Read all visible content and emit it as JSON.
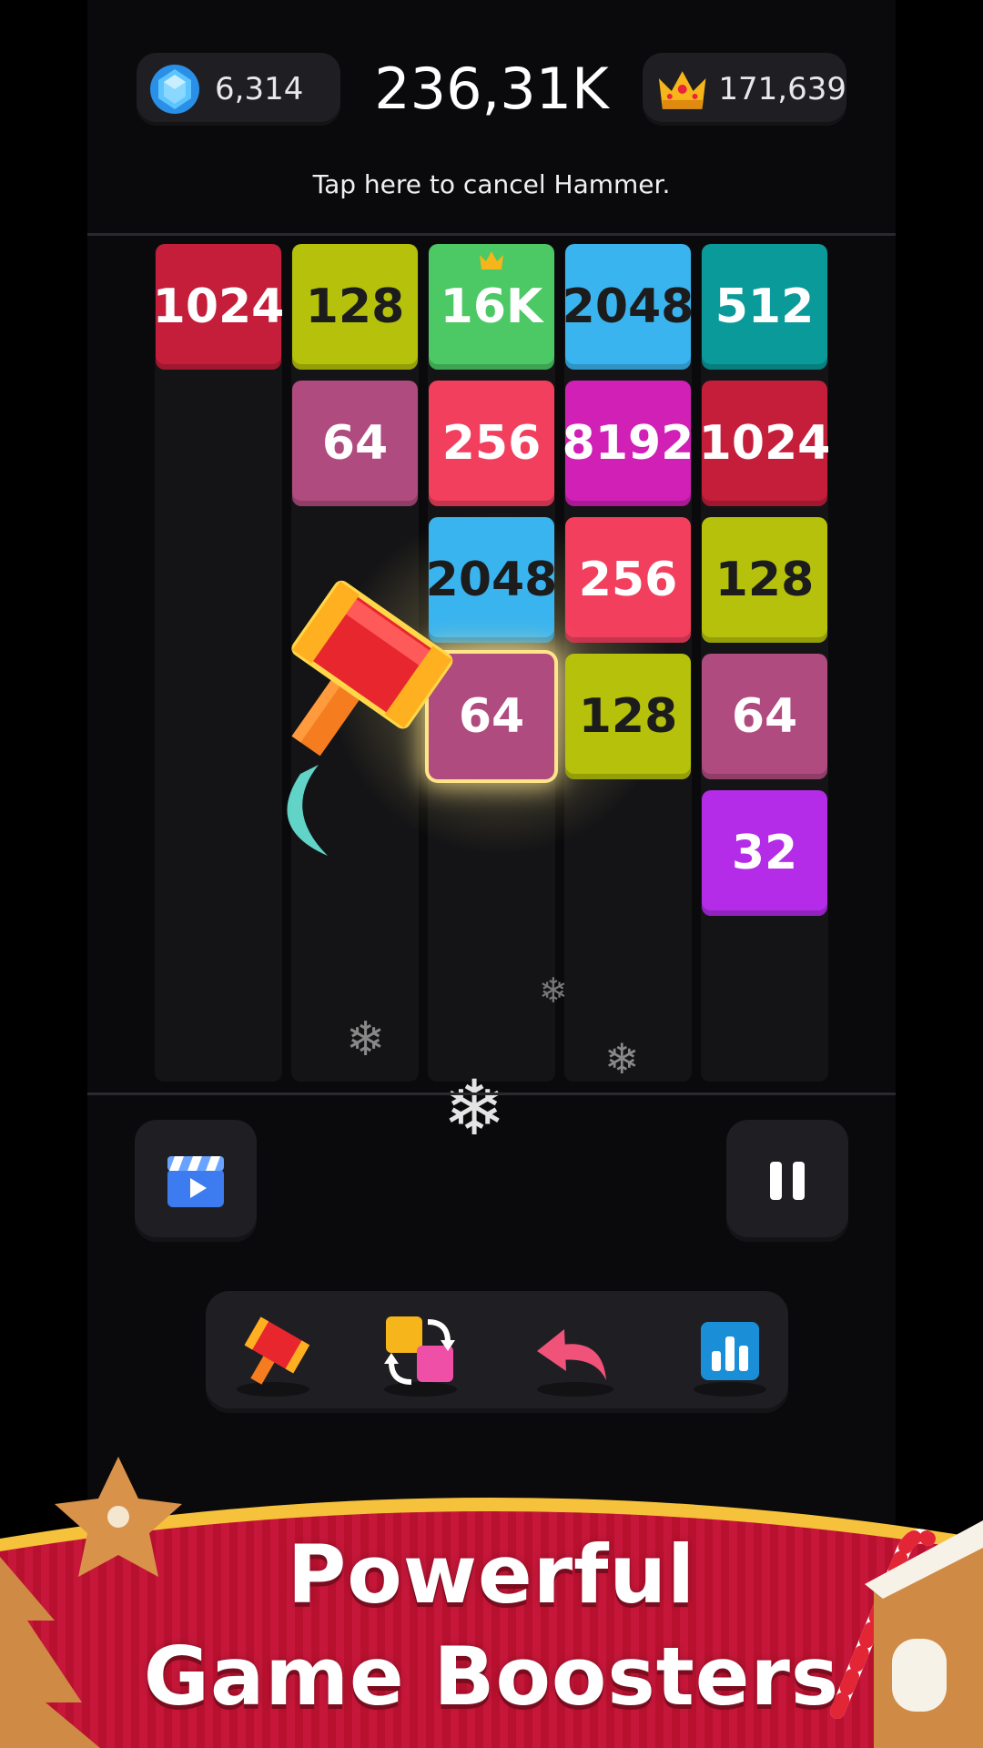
{
  "header": {
    "gems": "6,314",
    "score": "236,31K",
    "best": "171,639",
    "hint": "Tap here to cancel Hammer."
  },
  "board": {
    "tiles": [
      {
        "col": 0,
        "row": 0,
        "label": "1024",
        "color": "#c41e3a"
      },
      {
        "col": 1,
        "row": 0,
        "label": "128",
        "color": "#b5c10b"
      },
      {
        "col": 2,
        "row": 0,
        "label": "16K",
        "color": "#4cc864",
        "crown": true
      },
      {
        "col": 3,
        "row": 0,
        "label": "2048",
        "color": "#3ab4ef"
      },
      {
        "col": 4,
        "row": 0,
        "label": "512",
        "color": "#0a9a9a"
      },
      {
        "col": 1,
        "row": 1,
        "label": "64",
        "color": "#b04b7f"
      },
      {
        "col": 2,
        "row": 1,
        "label": "256",
        "color": "#f23f5e"
      },
      {
        "col": 3,
        "row": 1,
        "label": "8192",
        "color": "#d020b6"
      },
      {
        "col": 4,
        "row": 1,
        "label": "1024",
        "color": "#c41e3a"
      },
      {
        "col": 2,
        "row": 2,
        "label": "2048",
        "color": "#3ab4ef"
      },
      {
        "col": 3,
        "row": 2,
        "label": "256",
        "color": "#f23f5e"
      },
      {
        "col": 4,
        "row": 2,
        "label": "128",
        "color": "#b5c10b"
      },
      {
        "col": 2,
        "row": 3,
        "label": "64",
        "color": "#b04b7f",
        "selected": true
      },
      {
        "col": 3,
        "row": 3,
        "label": "128",
        "color": "#b5c10b"
      },
      {
        "col": 4,
        "row": 3,
        "label": "64",
        "color": "#b04b7f"
      },
      {
        "col": 4,
        "row": 4,
        "label": "32",
        "color": "#b42be8"
      }
    ]
  },
  "controls": {
    "video_icon": "clapperboard-play-icon",
    "pause_icon": "pause-icon",
    "boosters": [
      "hammer-icon",
      "swap-icon",
      "undo-icon",
      "leaderboard-icon"
    ]
  },
  "banner": {
    "line1": "Powerful",
    "line2": "Game Boosters"
  }
}
